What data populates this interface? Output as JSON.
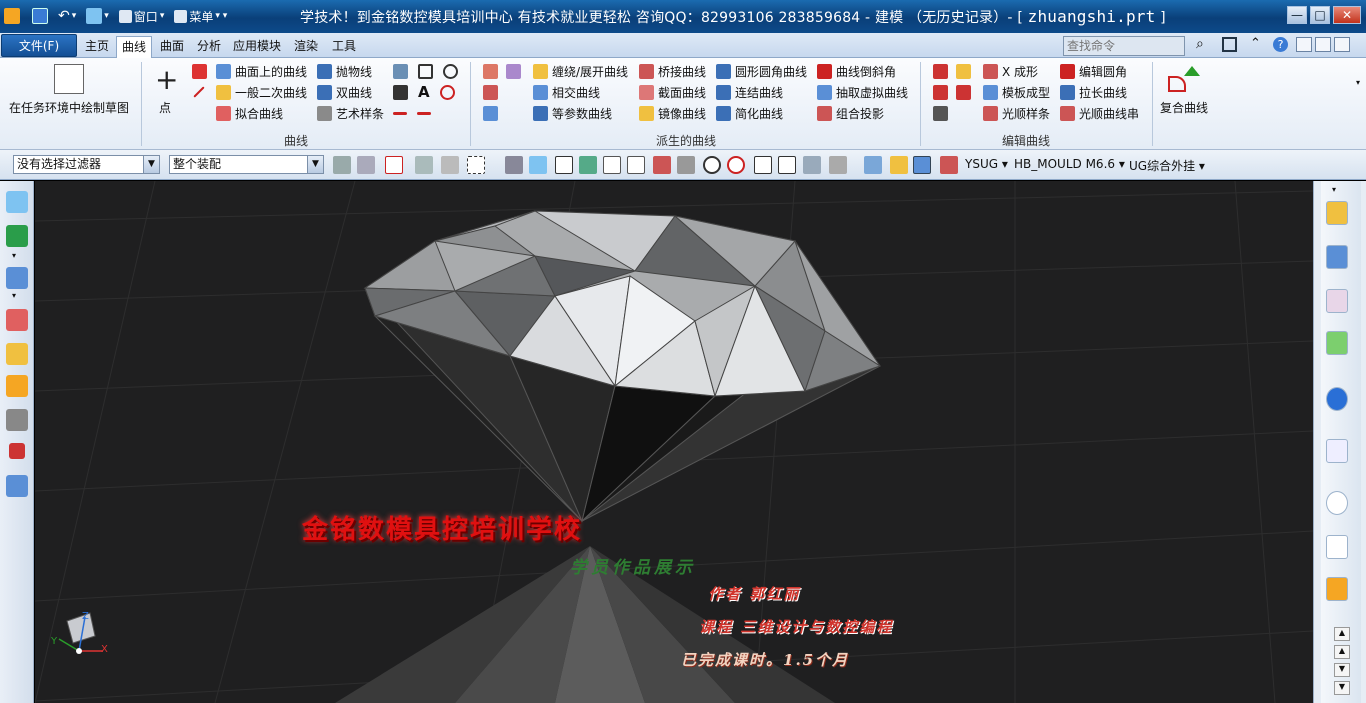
{
  "window": {
    "title": "学技术！到金铭数控模具培训中心 有技术就业更轻松  咨询QQ：82993106   283859684 - 建模 （无历史记录）- [",
    "filename": "zhuangshi.prt",
    "title_close": "]",
    "quick_access": {
      "window_label": "窗口",
      "menu_label": "菜单"
    },
    "controls": {
      "minimize": "—",
      "maximize": "□",
      "close": "✕"
    }
  },
  "menubar": {
    "file": "文件(F)",
    "tabs": [
      "主页",
      "曲线",
      "曲面",
      "分析",
      "应用模块",
      "渲染",
      "工具"
    ],
    "active_tab": "曲线",
    "search_placeholder": "查找命令"
  },
  "ribbon": {
    "sketch": {
      "label": "在任务环境中绘制草图"
    },
    "curve_group": {
      "point_label": "点",
      "items": [
        "曲面上的曲线",
        "一般二次曲线",
        "拟合曲线",
        "抛物线",
        "双曲线",
        "艺术样条"
      ],
      "label": "曲线"
    },
    "derived_group": {
      "items": [
        "缠绕/展开曲线",
        "相交曲线",
        "等参数曲线",
        "桥接曲线",
        "截面曲线",
        "镜像曲线",
        "圆形圆角曲线",
        "连结曲线",
        "简化曲线",
        "曲线倒斜角",
        "抽取虚拟曲线",
        "组合投影"
      ],
      "label": "派生的曲线"
    },
    "edit_group": {
      "items": [
        "X 成形",
        "模板成型",
        "光顺样条",
        "编辑圆角",
        "拉长曲线",
        "光顺曲线串"
      ],
      "label": "编辑曲线"
    },
    "composite": {
      "label": "复合曲线"
    }
  },
  "toolbar": {
    "filter": "没有选择过滤器",
    "assembly": "整个装配",
    "menus": [
      "YSUG",
      "HB_MOULD M6.6",
      "UG综合外挂"
    ]
  },
  "viewport": {
    "watermark": {
      "school": "金铭数模具控培训学校",
      "subtitle": "学员作品展示",
      "author": "作者  郭红丽",
      "course": "课程    三维设计与数控编程",
      "status": "已完成课时。1.5个月"
    },
    "triad": {
      "x": "X",
      "y": "Y",
      "z": "Z"
    }
  },
  "colors": {
    "title_bar": "#0a3f79",
    "viewport_bg": "#1f1f20",
    "watermark_red": "#e01010",
    "watermark_green": "#2e7d32"
  }
}
